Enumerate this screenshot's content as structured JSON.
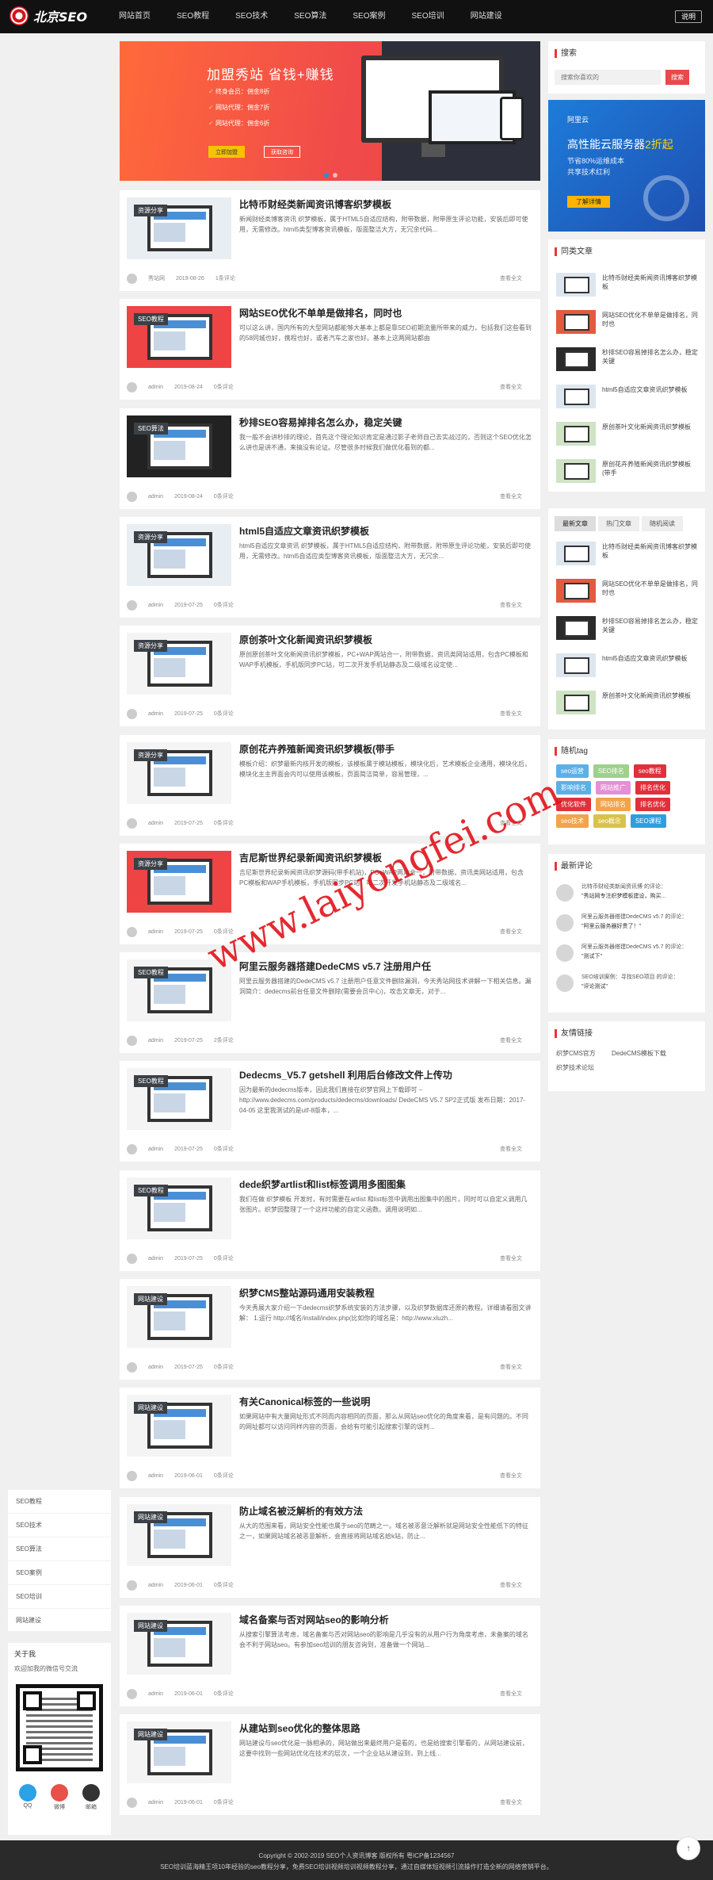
{
  "site": {
    "logo": "北京SEO",
    "explain_button": "说明",
    "nav": [
      "网站首页",
      "SEO教程",
      "SEO技术",
      "SEO算法",
      "SEO案例",
      "SEO培训",
      "网站建设"
    ]
  },
  "banner": {
    "title": "加盟秀站 省钱+赚钱",
    "points": [
      "终身会员：佣金8折",
      "网站代理：佣金7折",
      "网站代理：佣金6折"
    ],
    "button1": "立即加盟",
    "button2": "获取咨询"
  },
  "articles": [
    {
      "tag": "资源分享",
      "title": "比特币财经类新闻资讯博客织梦模板",
      "excerpt": "新闻财经类博客资讯 织梦模板，属于HTML5自适应结构，附带数据，附带原生评论功能，安装后即可使用，无需修改。html5类型博客资讯模板，版面整洁大方，无冗余代码...",
      "author": "秀站网",
      "date": "2019-08-26",
      "comments": "1条评论",
      "more": "查看全文"
    },
    {
      "tag": "SEO教程",
      "title": "网站SEO优化不单单是做排名，同时也",
      "excerpt": "可以这么讲，国内所有的大型网站都能够大基本上都是靠SEO初期流量所带来的威力，包括我们这些看到的58同城也好，携程也好，或者汽车之家也好。基本上这两网站都由",
      "author": "admin",
      "date": "2019-08-24",
      "comments": "0条评论",
      "more": "查看全文"
    },
    {
      "tag": "SEO算法",
      "title": "秒排SEO容易掉排名怎么办，稳定关键",
      "excerpt": "我一般不会讲秒排的理论，首先这个理论知识肯定是通过影子老师自己去实战过的，否则这个SEO优化怎么讲也是讲不通，来搞没有论证。尽管很多时候我们做优化看到的都...",
      "author": "admin",
      "date": "2019-08-24",
      "comments": "0条评论",
      "more": "查看全文"
    },
    {
      "tag": "资源分享",
      "title": "html5自适应文章资讯织梦模板",
      "excerpt": "html5自适应文章资讯 织梦模板，属于HTML5自适应结构，附带数据，附带原生评论功能，安装后即可使用，无需修改。html5自适应类型博客资讯模板，版面整洁大方，无冗余...",
      "author": "admin",
      "date": "2019-07-25",
      "comments": "0条评论",
      "more": "查看全文"
    },
    {
      "tag": "资源分享",
      "title": "原创茶叶文化新闻资讯织梦模板",
      "excerpt": "原创原创茶叶文化新闻资讯织梦模板，PC+WAP两站合一，附带数据，资讯类网站适用，包含PC模板和WAP手机模板，手机版同步PC站，可二次开发手机站静态及二级域名设定使...",
      "author": "admin",
      "date": "2019-07-25",
      "comments": "0条评论",
      "more": "查看全文"
    },
    {
      "tag": "资源分享",
      "title": "原创花卉养殖新闻资讯织梦模板(带手",
      "excerpt": "模板介绍：织梦最新内核开发的模板，该模板属于模站模板，模块化后，艺术模板企业通用，模块化后，模块化主主界面会内可以使用该模板，页面简洁简单，容易管理，...",
      "author": "admin",
      "date": "2019-07-25",
      "comments": "0条评论",
      "more": "查看全文"
    },
    {
      "tag": "资源分享",
      "title": "吉尼斯世界纪录新闻资讯织梦模板",
      "excerpt": "吉尼斯世界纪录新闻资讯织梦源码(带手机站)，PC+WAP两站合一，附带数据，资讯类网站适用，包含PC模板和WAP手机模板，手机版同步PC站，可二次开发手机站静态及二级域名...",
      "author": "admin",
      "date": "2019-07-25",
      "comments": "0条评论",
      "more": "查看全文"
    },
    {
      "tag": "SEO教程",
      "title": "阿里云服务器搭建DedeCMS v5.7 注册用户任",
      "excerpt": "阿里云服务器搭建的DedeCMS v5.7 注册用户任意文件删除漏洞，今天秀站网技术讲解一下相关信息。漏洞简介：dedecms前台任意文件删除(需要会员中心)，攻击文章无，对于...",
      "author": "admin",
      "date": "2019-07-25",
      "comments": "2条评论",
      "more": "查看全文"
    },
    {
      "tag": "SEO教程",
      "title": "Dedecms_V5.7 getshell 利用后台修改文件上传功",
      "excerpt": "因为最新的dedecms版本，因此我们直接在织梦官网上下载即可 – http://www.dedecms.com/products/dedecms/downloads/ DedeCMS V5.7 SP2正式版 发布日期：2017-04-05 这里我测试的是utf-8版本，...",
      "author": "admin",
      "date": "2019-07-25",
      "comments": "0条评论",
      "more": "查看全文"
    },
    {
      "tag": "SEO教程",
      "title": "dede织梦artlist和list标签调用多图图集",
      "excerpt": "我们在做 织梦模板 开发时，有时需要在artlist 和list标签中调用出图集中的图片，同时可以自定义调用几张图片。织梦园整理了一个这样功能的自定义函数。调用说明如...",
      "author": "admin",
      "date": "2019-07-25",
      "comments": "0条评论",
      "more": "查看全文"
    },
    {
      "tag": "网站建设",
      "title": "织梦CMS整站源码通用安装教程",
      "excerpt": "今天秀展大家介绍一下dedecms织梦系统安装的方法步骤，以及织梦数据库还原的教程。详细请看图文讲解： 1.运行 http://域名/install/index.php(比如你的域名是：http://www.xluzh...",
      "author": "admin",
      "date": "2019-07-25",
      "comments": "0条评论",
      "more": "查看全文"
    },
    {
      "tag": "网站建设",
      "title": "有关Canonical标签的一些说明",
      "excerpt": "如果网站中有大量网址形式不同而内容相同的页面，那么从网站seo优化的角度来看，是有问题的。不同的网址都可以访问同样内容的页面，会给有可能引起搜索引擎的误判...",
      "author": "admin",
      "date": "2019-06-01",
      "comments": "0条评论",
      "more": "查看全文"
    },
    {
      "tag": "网站建设",
      "title": "防止域名被泛解析的有效方法",
      "excerpt": "从大的范围来看，网站安全性能也属于seo的范畴之一。域名被恶意泛解析就是网站安全性能低下的特征之一，如果网站域名被恶意解析，会直接将网站域名给k站，防止...",
      "author": "admin",
      "date": "2019-06-01",
      "comments": "0条评论",
      "more": "查看全文"
    },
    {
      "tag": "网站建设",
      "title": "域名备案与否对网站seo的影响分析",
      "excerpt": "从搜索引擎算法考虑，域名备案与否对网站seo的影响是几乎没有的从用户行为角度考虑，未备案的域名会不利于网站seo。有参加seo培训的朋友咨询到，准备做一个网站...",
      "author": "admin",
      "date": "2019-06-01",
      "comments": "0条评论",
      "more": "查看全文"
    },
    {
      "tag": "网站建设",
      "title": "从建站到seo优化的整体思路",
      "excerpt": "网站建设与seo优化是一脉相承的，网站做出来最终用户是看的，也是给搜索引擎看的，从网站建设前，这要中找到一些网站优化在技术的层次，一个企业站从建设到，到上线...",
      "author": "admin",
      "date": "2019-06-01",
      "comments": "0条评论",
      "more": "查看全文"
    }
  ],
  "sidebar": {
    "search_title": "搜索",
    "search_placeholder": "搜索你喜欢的",
    "search_button": "搜索",
    "ad": {
      "brand": "阿里云",
      "headline_pre": "高性能云服务器",
      "headline_em": "2折起",
      "line1": "节省80%运维成本",
      "line2": "共享技术红利",
      "button": "了解详情"
    },
    "similar_title": "同类文章",
    "similar": [
      "比特币财经类新闻资讯博客织梦模板",
      "网站SEO优化不单单是做排名，同时也",
      "秒排SEO容易掉排名怎么办，稳定关键",
      "html5自适应文章资讯织梦模板",
      "原创茶叶文化新闻资讯织梦模板",
      "原创花卉养殖新闻资讯织梦模板(带手"
    ],
    "tabs": [
      "最新文章",
      "热门文章",
      "随机阅读"
    ],
    "latest": [
      "比特币财经类新闻资讯博客织梦模板",
      "网站SEO优化不单单是做排名，同时也",
      "秒排SEO容易掉排名怎么办，稳定关键",
      "html5自适应文章资讯织梦模板",
      "原创茶叶文化新闻资讯织梦模板"
    ],
    "tag_title": "随机tag",
    "tags": [
      {
        "t": "seo运营",
        "c": "#5bb0e8"
      },
      {
        "t": "SEO排名",
        "c": "#9fd08d"
      },
      {
        "t": "seo教程",
        "c": "#e0303b"
      },
      {
        "t": "影响排名",
        "c": "#5bb0e8"
      },
      {
        "t": "网站推广",
        "c": "#e58fd6"
      },
      {
        "t": "排名优化",
        "c": "#e0303b"
      },
      {
        "t": "优化软件",
        "c": "#e0303b"
      },
      {
        "t": "网站排名",
        "c": "#f3a34a"
      },
      {
        "t": "排名优化",
        "c": "#e0303b"
      },
      {
        "t": "seo技术",
        "c": "#f3a34a"
      },
      {
        "t": "seo概念",
        "c": "#d9c24a"
      },
      {
        "t": "SEO课程",
        "c": "#2f9ee0"
      }
    ],
    "comments_title": "最新评论",
    "comments": [
      {
        "who": "比特币财经类新闻资讯博 的评论：",
        "text": "\"秀站网专注织梦模板建设，购买..."
      },
      {
        "who": "阿里云服务器搭建DedeCMS v5.7 的评论：",
        "text": "\"阿里云服务器好贵了！\""
      },
      {
        "who": "阿里云服务器搭建DedeCMS v5.7 的评论：",
        "text": "\"测试下\""
      },
      {
        "who": "SEO培训案例：寻找SEO项目 的评论：",
        "text": "\"评论测试\""
      }
    ],
    "links_title": "友情链接",
    "links": [
      "织梦CMS官方",
      "DedeCMS模板下载",
      "织梦技术论坛"
    ]
  },
  "leftnav": [
    "SEO教程",
    "SEO技术",
    "SEO算法",
    "SEO案例",
    "SEO培训",
    "网站建设"
  ],
  "about": {
    "title": "关于我",
    "desc": "欢迎加我的微信号交流",
    "socials": [
      {
        "l": "QQ",
        "c": "#2ba1e6"
      },
      {
        "l": "微博",
        "c": "#e8504a"
      },
      {
        "l": "邮箱",
        "c": "#333333"
      }
    ]
  },
  "watermark": "www.laiyongfei.com",
  "footer": {
    "line1": "Copyright © 2002-2019 SEO个人资讯博客 版权所有 粤ICP备1234567",
    "line2": "SEO培训蓝海精王项10年经验的seo教程分享，免费SEO培训视频培训视频教程分享，通过自媒体短视频引流操作打造全新的网络营销平台。"
  }
}
